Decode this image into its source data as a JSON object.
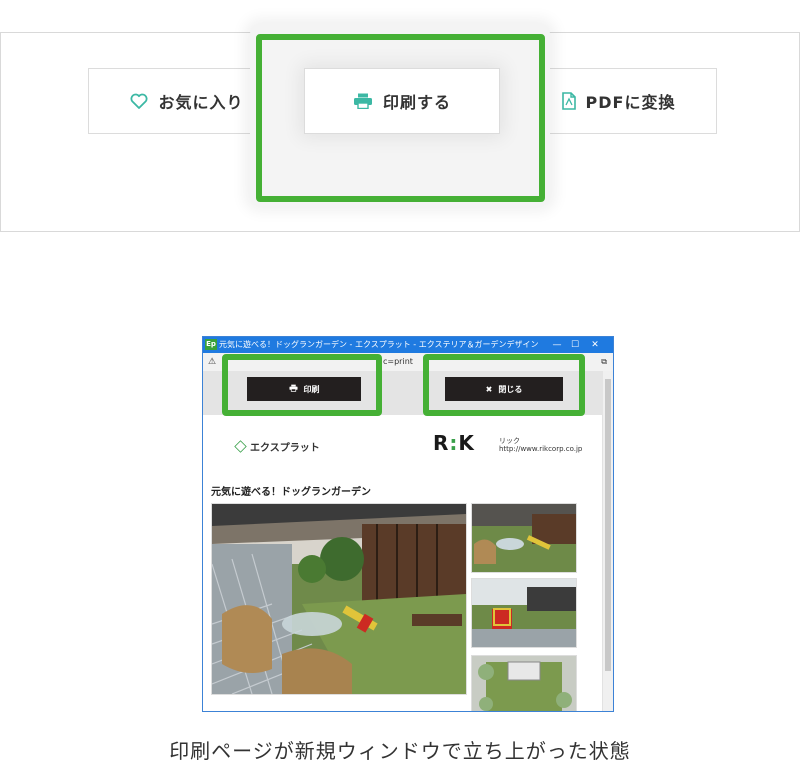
{
  "top_buttons": {
    "favorite_label": "お気に入り",
    "print_label": "印刷する",
    "pdf_label": "PDFに変換"
  },
  "window": {
    "app_icon": "Ep",
    "title": "元気に遊べる！ドッグランガーデン - エクスプラット - エクステリア＆ガーデンデザイン・プラン検索サイト｜RIKCADデ...",
    "address": "c=print",
    "print_button": "印刷",
    "close_button": "閉じる",
    "logo_text": "エクスプラット",
    "rik_logo": "R:K",
    "rik_kana": "リック",
    "rik_url": "http://www.rikcorp.co.jp",
    "page_title": "元気に遊べる！ドッグランガーデン"
  },
  "caption": "印刷ページが新規ウィンドウで立ち上がった状態",
  "colors": {
    "highlight": "#45b035",
    "accent_icon": "#3cb8a4",
    "dark_button": "#231f1f",
    "titlebar": "#1f7ae0"
  }
}
